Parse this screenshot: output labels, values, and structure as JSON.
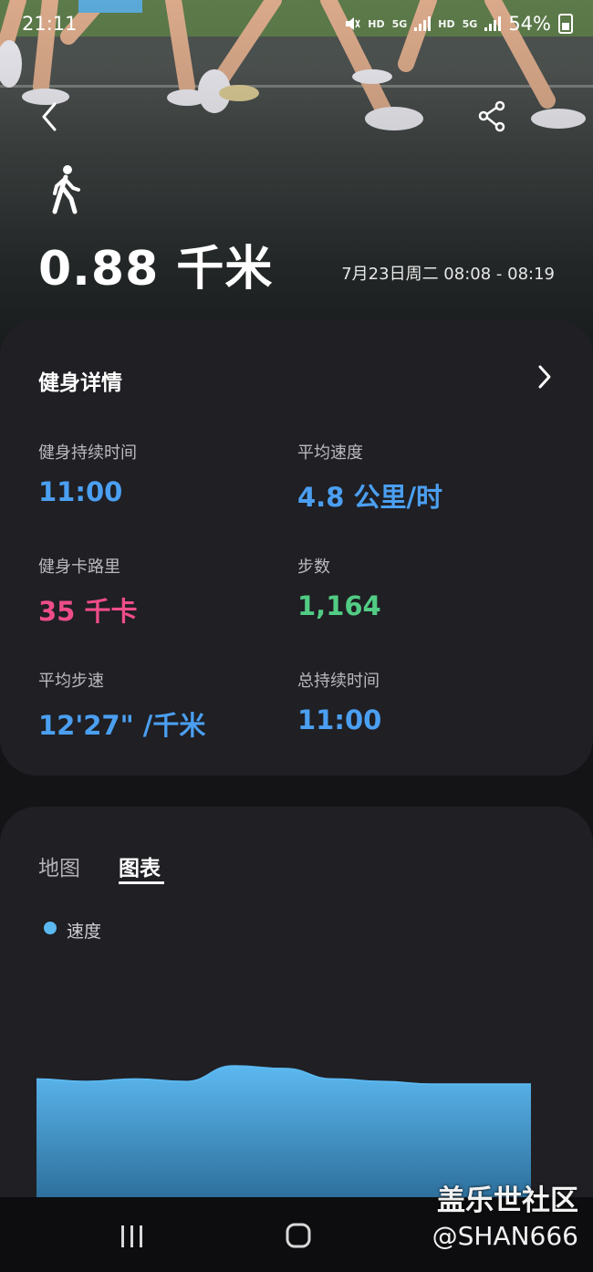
{
  "status_bar": {
    "time": "21:11",
    "network_1": "HD",
    "network_2": "5G",
    "network_3": "HD",
    "network_4": "5G",
    "battery": "54%"
  },
  "header": {
    "distance": "0.88 千米",
    "date_range": "7月23日周二 08:08 - 08:19",
    "icons": [
      "back-icon",
      "share-icon",
      "walking-icon"
    ]
  },
  "details": {
    "title": "健身详情",
    "metrics": [
      {
        "label": "健身持续时间",
        "value": "11:00",
        "color": "#4b9ff1"
      },
      {
        "label": "平均速度",
        "value": "4.8 公里/时",
        "color": "#4b9ff1"
      },
      {
        "label": "健身卡路里",
        "value": "35 千卡",
        "color": "#ef4d8a"
      },
      {
        "label": "步数",
        "value": "1,164",
        "color": "#52cc84"
      },
      {
        "label": "平均步速",
        "value": "12'27\" /千米",
        "color": "#4b9ff1"
      },
      {
        "label": "总持续时间",
        "value": "11:00",
        "color": "#4b9ff1"
      }
    ]
  },
  "chart_card": {
    "tabs": [
      {
        "label": "地图",
        "selected": false
      },
      {
        "label": "图表",
        "selected": true
      }
    ],
    "legend": "速度",
    "legend_color": "#5cb8f0"
  },
  "chart_data": {
    "type": "area",
    "series": [
      {
        "name": "速度",
        "values": [
          4.6,
          4.5,
          4.6,
          4.5,
          5.1,
          5.0,
          4.6,
          4.5,
          4.4,
          4.4,
          4.4
        ]
      }
    ],
    "ylim": [
      0,
      7
    ]
  },
  "watermark": {
    "line1": "盖乐世社区",
    "line2": "@SHAN666"
  }
}
